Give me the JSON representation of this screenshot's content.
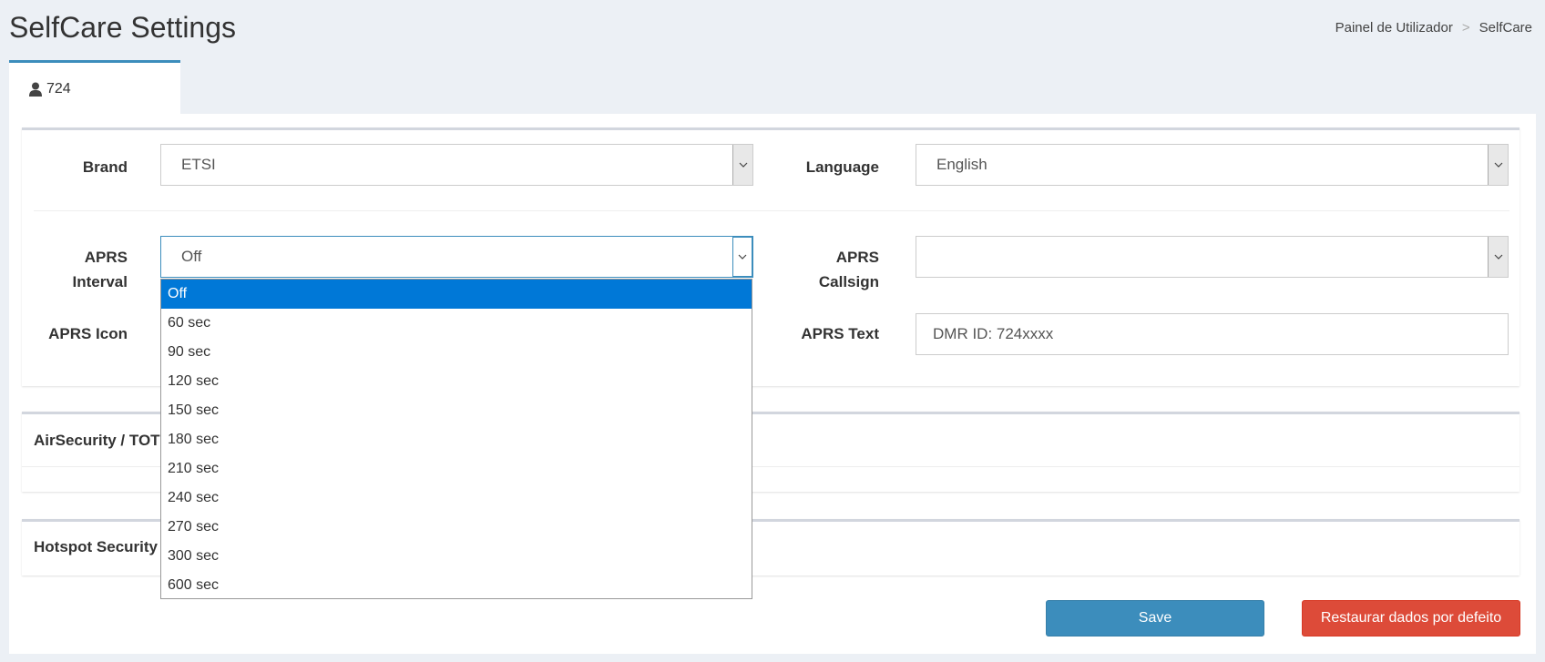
{
  "header": {
    "title": "SelfCare Settings",
    "breadcrumb": [
      "Painel de Utilizador",
      "SelfCare"
    ],
    "breadcrumb_separator": ">"
  },
  "tab": {
    "icon": "user-icon",
    "label": "724"
  },
  "form": {
    "brand": {
      "label": "Brand",
      "value": "ETSI"
    },
    "language": {
      "label": "Language",
      "value": "English"
    },
    "aprs_interval": {
      "label_line1": "APRS",
      "label_line2": "Interval",
      "value": "Off"
    },
    "aprs_callsign": {
      "label_line1": "APRS",
      "label_line2": "Callsign",
      "value": ""
    },
    "aprs_icon": {
      "label": "APRS Icon"
    },
    "aprs_text": {
      "label": "APRS Text",
      "value": "DMR ID: 724xxxx"
    }
  },
  "sections": {
    "airsecurity": "AirSecurity / TOT",
    "hotspot": "Hotspot Security"
  },
  "dropdown": {
    "options": [
      "Off",
      "60 sec",
      "90 sec",
      "120 sec",
      "150 sec",
      "180 sec",
      "210 sec",
      "240 sec",
      "270 sec",
      "300 sec",
      "600 sec"
    ],
    "selected_index": 0
  },
  "buttons": {
    "save": "Save",
    "reset": "Restaurar dados por defeito"
  },
  "colors": {
    "accent": "#3c8dbc",
    "danger": "#dd4b39",
    "selected": "#0078d7"
  }
}
